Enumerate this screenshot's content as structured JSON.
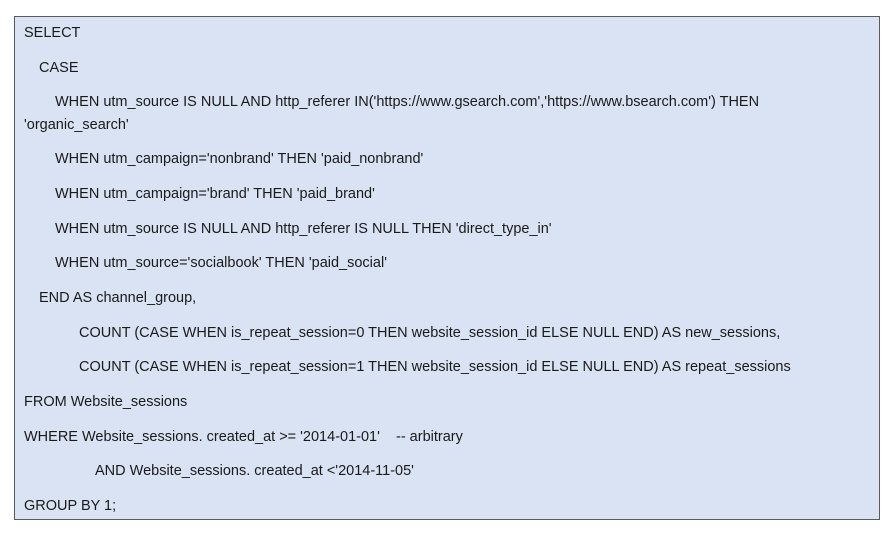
{
  "code": {
    "lines": [
      "SELECT",
      "CASE",
      "WHEN utm_source IS NULL AND http_referer IN('https://www.gsearch.com','https://www.bsearch.com') THEN",
      "'organic_search'",
      "WHEN utm_campaign='nonbrand' THEN 'paid_nonbrand'",
      "WHEN utm_campaign='brand' THEN 'paid_brand'",
      "WHEN utm_source IS NULL AND http_referer IS NULL THEN 'direct_type_in'",
      "WHEN utm_source='socialbook' THEN 'paid_social'",
      "END AS channel_group,",
      "COUNT (CASE WHEN is_repeat_session=0 THEN website_session_id ELSE NULL END) AS new_sessions,",
      "COUNT (CASE WHEN is_repeat_session=1 THEN website_session_id ELSE NULL END) AS repeat_sessions",
      "FROM Website_sessions",
      "WHERE Website_sessions. created_at >= '2014-01-01'    -- arbitrary",
      "AND Website_sessions. created_at <'2014-11-05'",
      "GROUP BY 1;"
    ]
  }
}
